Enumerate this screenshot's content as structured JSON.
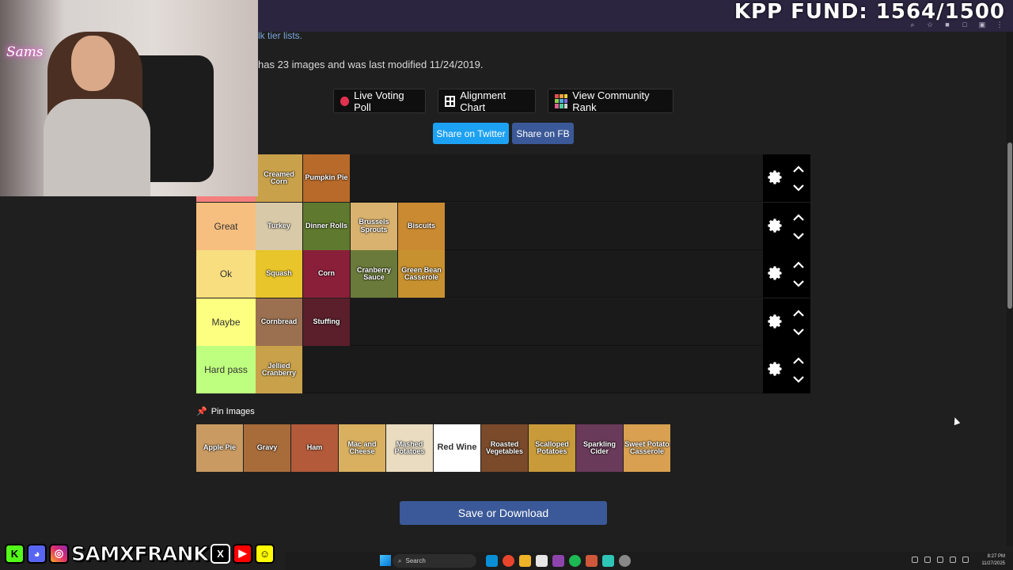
{
  "stream_overlay": {
    "fund_text": "KPP FUND: 1564/1500",
    "neon_sign": "Sams",
    "handle": "SAMXFRANK"
  },
  "page": {
    "link_fragment": "lk tier lists.",
    "info_text": "has 23 images and was last modified 11/24/2019."
  },
  "toolbar": {
    "live_voting_label": "Live Voting Poll",
    "alignment_chart_label": "Alignment Chart",
    "community_rank_label": "View Community Rank",
    "share_twitter_label": "Share on Twitter",
    "share_fb_label": "Share on FB"
  },
  "tiers": [
    {
      "label": "",
      "color": "#f47f7f",
      "items": [
        "Creamed Corn",
        "Pumpkin Pie"
      ]
    },
    {
      "label": "Great",
      "color": "#f7bf7f",
      "items": [
        "Turkey",
        "Dinner Rolls",
        "Brussels Sprouts",
        "Biscuits"
      ]
    },
    {
      "label": "Ok",
      "color": "#f8de7f",
      "items": [
        "Squash",
        "Corn",
        "Cranberry Sauce",
        "Green Bean Casserole"
      ]
    },
    {
      "label": "Maybe",
      "color": "#fcff7f",
      "items": [
        "Cornbread",
        "Stuffing"
      ]
    },
    {
      "label": "Hard pass",
      "color": "#bfff7f",
      "items": [
        "Jellied Cranberry"
      ]
    }
  ],
  "pin": {
    "title": "Pin Images",
    "items": [
      "Apple Pie",
      "Gravy",
      "Ham",
      "Mac and Cheese",
      "Mashed Potatoes",
      "Red Wine",
      "Roasted Vegetables",
      "Scalloped Potatoes",
      "Sparkling Cider",
      "Sweet Potato Casserole"
    ]
  },
  "save_label": "Save or Download",
  "taskbar": {
    "search_placeholder": "Search",
    "time": "8:27 PM",
    "date": "11/27/2025"
  },
  "colors": {
    "tile_bg": [
      "#c9a14a",
      "#b86a2a",
      "#d8c9a8",
      "#5f7a2e",
      "#d9b270",
      "#c98a32",
      "#e8c52a",
      "#8a1f3a",
      "#6a7a3a",
      "#c8912f",
      "#9a7050",
      "#5a1f2a"
    ],
    "pin_bg": [
      "#c99b62",
      "#a86b3a",
      "#b25a3a",
      "#d9b060",
      "#e9dcc0",
      "#ffffff",
      "#7a4a2a",
      "#c89a3a",
      "#6a3a5a",
      "#d8a050"
    ]
  }
}
